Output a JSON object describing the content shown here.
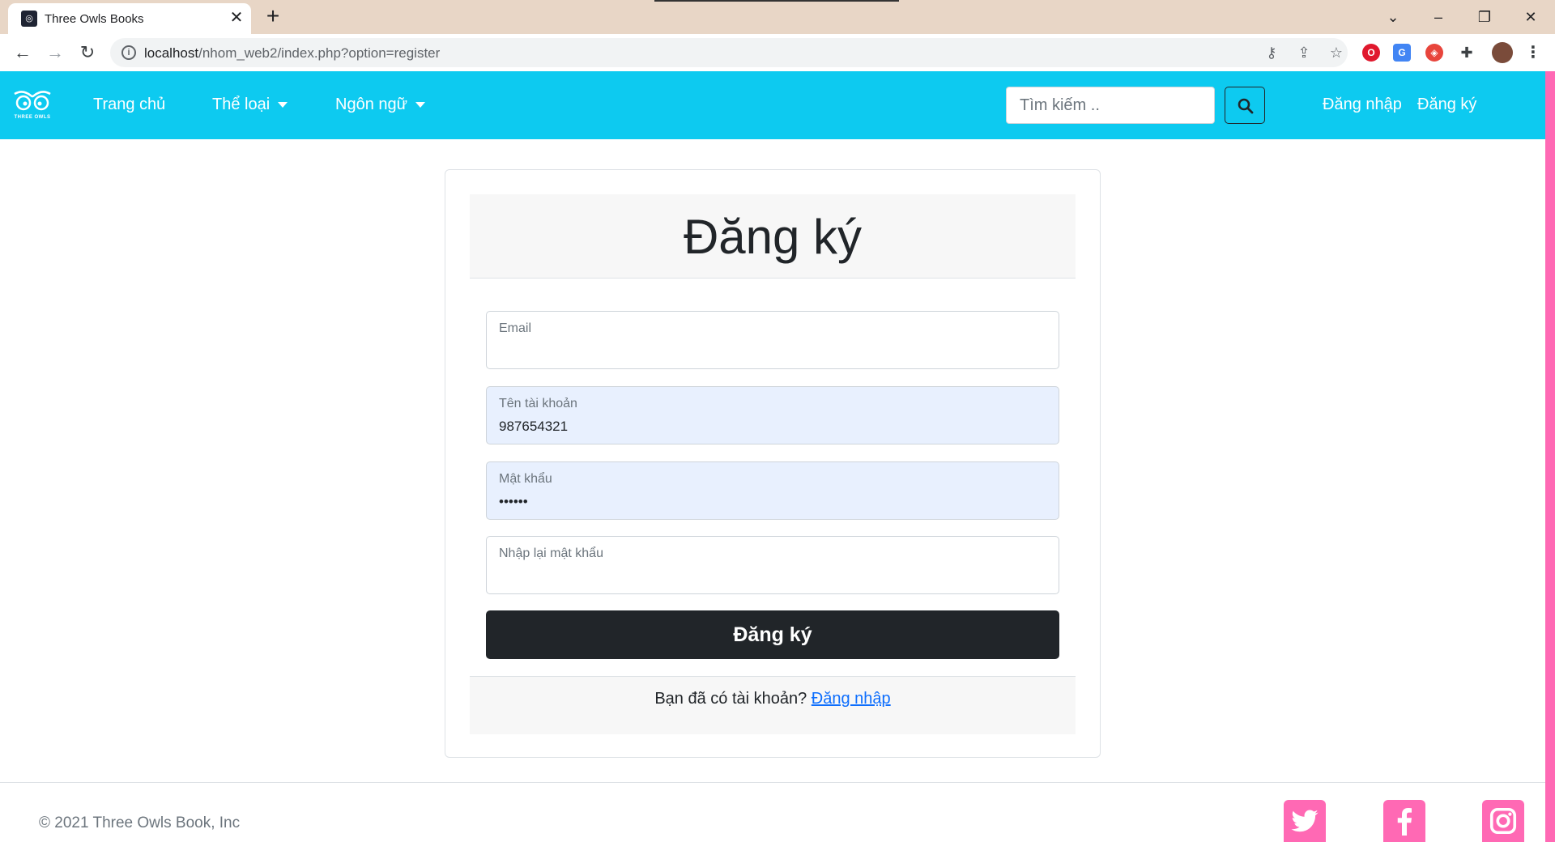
{
  "browser": {
    "tab_title": "Three Owls Books",
    "url_host": "localhost",
    "url_path": "/nhom_web2/index.php?option=register"
  },
  "navbar": {
    "logo_text": "THREE OWLS",
    "home": "Trang chủ",
    "category": "Thể loại",
    "language": "Ngôn ngữ",
    "search_placeholder": "Tìm kiếm ..",
    "login": "Đăng nhập",
    "register": "Đăng ký"
  },
  "form": {
    "title": "Đăng ký",
    "email_label": "Email",
    "email_value": "",
    "username_label": "Tên tài khoản",
    "username_value": "987654321",
    "password_label": "Mật khẩu",
    "password_value": "123456",
    "confirm_label": "Nhập lại mật khẩu",
    "confirm_value": "",
    "submit_label": "Đăng ký",
    "footer_text": "Bạn đã có tài khoản?",
    "footer_link": "Đăng nhập"
  },
  "footer": {
    "copyright": "© 2021 Three Owls Book, Inc",
    "social": [
      "twitter-icon",
      "facebook-icon",
      "instagram-icon"
    ]
  },
  "colors": {
    "navbar": "#0dcaf0",
    "accent_pink": "#ff69b4",
    "button_dark": "#212529",
    "autofill": "#e8f0fe"
  }
}
